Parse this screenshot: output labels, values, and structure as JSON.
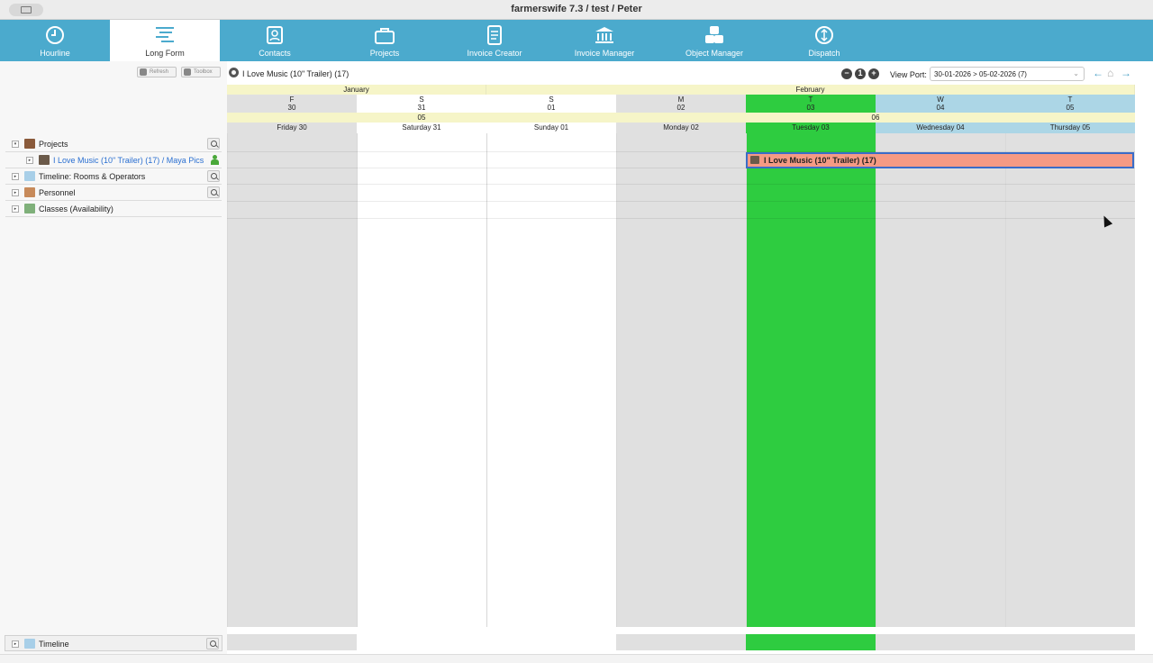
{
  "window": {
    "title": "farmerswife 7.3  / test / Peter"
  },
  "nav": {
    "tabs": [
      {
        "label": "Hourline",
        "icon": "clock-icon"
      },
      {
        "label": "Long Form",
        "icon": "longform-icon",
        "active": true
      },
      {
        "label": "Contacts",
        "icon": "contacts-icon"
      },
      {
        "label": "Projects",
        "icon": "briefcase-icon"
      },
      {
        "label": "Invoice Creator",
        "icon": "document-icon"
      },
      {
        "label": "Invoice Manager",
        "icon": "bank-icon"
      },
      {
        "label": "Object Manager",
        "icon": "blocks-icon"
      },
      {
        "label": "Dispatch",
        "icon": "dispatch-icon"
      }
    ]
  },
  "toolbar": {
    "refresh_label": "Refresh",
    "toolbox_label": "Toolbox"
  },
  "tree": {
    "items": [
      {
        "label": "Projects",
        "expanded": true
      },
      {
        "label": "I Love Music (10\" Trailer) (17) / Maya Pics"
      },
      {
        "label": "Timeline: Rooms & Operators"
      },
      {
        "label": "Personnel"
      },
      {
        "label": "Classes (Availability)"
      }
    ],
    "bottom_label": "Timeline"
  },
  "header": {
    "project_title": "I Love Music (10\" Trailer) (17)",
    "viewport_label": "View Port:",
    "viewport_value": "30-01-2026 > 05-02-2026 (7)"
  },
  "calendar": {
    "months": [
      {
        "label": "January"
      },
      {
        "label": "February"
      }
    ],
    "weeks": [
      {
        "label": "05"
      },
      {
        "label": "06"
      }
    ],
    "days": [
      {
        "letter": "F",
        "num": "30",
        "name": "Friday 30",
        "kind": "weekday"
      },
      {
        "letter": "S",
        "num": "31",
        "name": "Saturday 31",
        "kind": "weekend"
      },
      {
        "letter": "S",
        "num": "01",
        "name": "Sunday 01",
        "kind": "weekend"
      },
      {
        "letter": "M",
        "num": "02",
        "name": "Monday 02",
        "kind": "weekday"
      },
      {
        "letter": "T",
        "num": "03",
        "name": "Tuesday 03",
        "kind": "today"
      },
      {
        "letter": "W",
        "num": "04",
        "name": "Wednesday 04",
        "kind": "booked"
      },
      {
        "letter": "T",
        "num": "05",
        "name": "Thursday 05",
        "kind": "booked"
      }
    ],
    "booking": {
      "label": "I Love Music (10\" Trailer) (17)"
    },
    "colors": {
      "today": "#2ecc40",
      "weekday": "#e0e0e0",
      "weekend": "#ffffff",
      "booked_head": "#acd6e6",
      "booking": "#f59a84",
      "nav": "#4baacd"
    }
  }
}
